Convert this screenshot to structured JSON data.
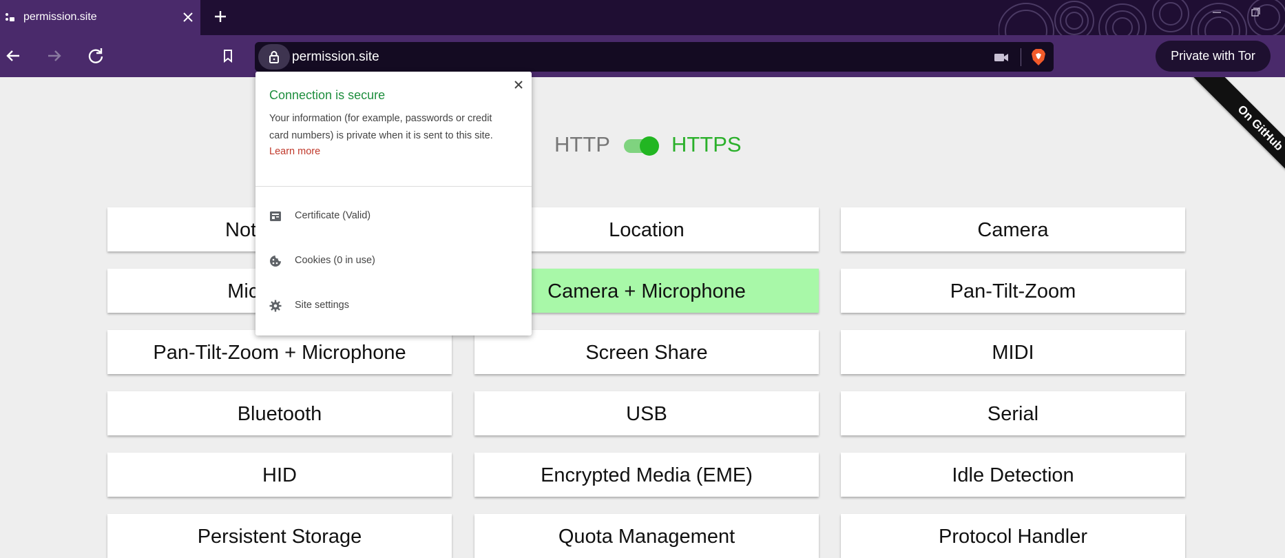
{
  "browser": {
    "tab": {
      "title": "permission.site"
    },
    "address_bar": {
      "url": "permission.site"
    },
    "private_tor_button": "Private with Tor"
  },
  "page": {
    "github_ribbon": "On GitHub",
    "protocol_toggle": {
      "http_label": "HTTP",
      "https_label": "HTTPS",
      "selected": "HTTPS"
    },
    "permissions": [
      {
        "label": "Notifications",
        "state": "default"
      },
      {
        "label": "Location",
        "state": "default"
      },
      {
        "label": "Camera",
        "state": "default"
      },
      {
        "label": "Microphone",
        "state": "default"
      },
      {
        "label": "Camera + Microphone",
        "state": "granted"
      },
      {
        "label": "Pan-Tilt-Zoom",
        "state": "default"
      },
      {
        "label": "Pan-Tilt-Zoom + Microphone",
        "state": "default"
      },
      {
        "label": "Screen Share",
        "state": "default"
      },
      {
        "label": "MIDI",
        "state": "default"
      },
      {
        "label": "Bluetooth",
        "state": "default"
      },
      {
        "label": "USB",
        "state": "default"
      },
      {
        "label": "Serial",
        "state": "default"
      },
      {
        "label": "HID",
        "state": "default"
      },
      {
        "label": "Encrypted Media (EME)",
        "state": "default"
      },
      {
        "label": "Idle Detection",
        "state": "default"
      },
      {
        "label": "Persistent Storage",
        "state": "default"
      },
      {
        "label": "Quota Management",
        "state": "default"
      },
      {
        "label": "Protocol Handler",
        "state": "default"
      }
    ]
  },
  "site_info_popup": {
    "heading": "Connection is secure",
    "body": "Your information (for example, passwords or credit card numbers) is private when it is sent to this site.",
    "learn_more": "Learn more",
    "rows": [
      {
        "label": "Certificate (Valid)",
        "icon": "certificate-icon"
      },
      {
        "label": "Cookies (0 in use)",
        "icon": "cookie-icon"
      },
      {
        "label": "Site settings",
        "icon": "gear-icon"
      }
    ]
  },
  "colors": {
    "titlebar": "#1f0e33",
    "toolbar": "#4a2a6b",
    "secure_green": "#1e8e3e",
    "https_green": "#2bb02b",
    "granted_bg": "#a8f8a8",
    "link_red": "#c0392b"
  }
}
